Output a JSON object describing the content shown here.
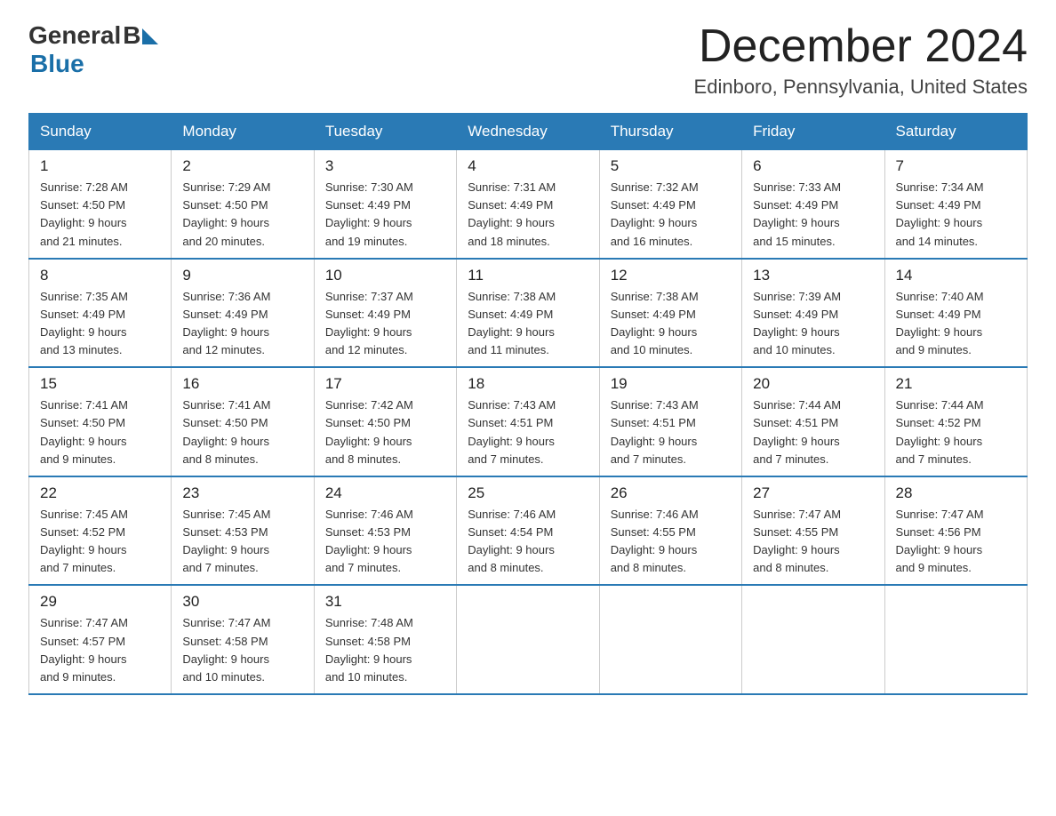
{
  "logo": {
    "general": "General",
    "blue": "Blue",
    "arrow": "▶"
  },
  "title": "December 2024",
  "subtitle": "Edinboro, Pennsylvania, United States",
  "days_of_week": [
    "Sunday",
    "Monday",
    "Tuesday",
    "Wednesday",
    "Thursday",
    "Friday",
    "Saturday"
  ],
  "weeks": [
    [
      {
        "day": "1",
        "sunrise": "7:28 AM",
        "sunset": "4:50 PM",
        "daylight": "9 hours and 21 minutes."
      },
      {
        "day": "2",
        "sunrise": "7:29 AM",
        "sunset": "4:50 PM",
        "daylight": "9 hours and 20 minutes."
      },
      {
        "day": "3",
        "sunrise": "7:30 AM",
        "sunset": "4:49 PM",
        "daylight": "9 hours and 19 minutes."
      },
      {
        "day": "4",
        "sunrise": "7:31 AM",
        "sunset": "4:49 PM",
        "daylight": "9 hours and 18 minutes."
      },
      {
        "day": "5",
        "sunrise": "7:32 AM",
        "sunset": "4:49 PM",
        "daylight": "9 hours and 16 minutes."
      },
      {
        "day": "6",
        "sunrise": "7:33 AM",
        "sunset": "4:49 PM",
        "daylight": "9 hours and 15 minutes."
      },
      {
        "day": "7",
        "sunrise": "7:34 AM",
        "sunset": "4:49 PM",
        "daylight": "9 hours and 14 minutes."
      }
    ],
    [
      {
        "day": "8",
        "sunrise": "7:35 AM",
        "sunset": "4:49 PM",
        "daylight": "9 hours and 13 minutes."
      },
      {
        "day": "9",
        "sunrise": "7:36 AM",
        "sunset": "4:49 PM",
        "daylight": "9 hours and 12 minutes."
      },
      {
        "day": "10",
        "sunrise": "7:37 AM",
        "sunset": "4:49 PM",
        "daylight": "9 hours and 12 minutes."
      },
      {
        "day": "11",
        "sunrise": "7:38 AM",
        "sunset": "4:49 PM",
        "daylight": "9 hours and 11 minutes."
      },
      {
        "day": "12",
        "sunrise": "7:38 AM",
        "sunset": "4:49 PM",
        "daylight": "9 hours and 10 minutes."
      },
      {
        "day": "13",
        "sunrise": "7:39 AM",
        "sunset": "4:49 PM",
        "daylight": "9 hours and 10 minutes."
      },
      {
        "day": "14",
        "sunrise": "7:40 AM",
        "sunset": "4:49 PM",
        "daylight": "9 hours and 9 minutes."
      }
    ],
    [
      {
        "day": "15",
        "sunrise": "7:41 AM",
        "sunset": "4:50 PM",
        "daylight": "9 hours and 9 minutes."
      },
      {
        "day": "16",
        "sunrise": "7:41 AM",
        "sunset": "4:50 PM",
        "daylight": "9 hours and 8 minutes."
      },
      {
        "day": "17",
        "sunrise": "7:42 AM",
        "sunset": "4:50 PM",
        "daylight": "9 hours and 8 minutes."
      },
      {
        "day": "18",
        "sunrise": "7:43 AM",
        "sunset": "4:51 PM",
        "daylight": "9 hours and 7 minutes."
      },
      {
        "day": "19",
        "sunrise": "7:43 AM",
        "sunset": "4:51 PM",
        "daylight": "9 hours and 7 minutes."
      },
      {
        "day": "20",
        "sunrise": "7:44 AM",
        "sunset": "4:51 PM",
        "daylight": "9 hours and 7 minutes."
      },
      {
        "day": "21",
        "sunrise": "7:44 AM",
        "sunset": "4:52 PM",
        "daylight": "9 hours and 7 minutes."
      }
    ],
    [
      {
        "day": "22",
        "sunrise": "7:45 AM",
        "sunset": "4:52 PM",
        "daylight": "9 hours and 7 minutes."
      },
      {
        "day": "23",
        "sunrise": "7:45 AM",
        "sunset": "4:53 PM",
        "daylight": "9 hours and 7 minutes."
      },
      {
        "day": "24",
        "sunrise": "7:46 AM",
        "sunset": "4:53 PM",
        "daylight": "9 hours and 7 minutes."
      },
      {
        "day": "25",
        "sunrise": "7:46 AM",
        "sunset": "4:54 PM",
        "daylight": "9 hours and 8 minutes."
      },
      {
        "day": "26",
        "sunrise": "7:46 AM",
        "sunset": "4:55 PM",
        "daylight": "9 hours and 8 minutes."
      },
      {
        "day": "27",
        "sunrise": "7:47 AM",
        "sunset": "4:55 PM",
        "daylight": "9 hours and 8 minutes."
      },
      {
        "day": "28",
        "sunrise": "7:47 AM",
        "sunset": "4:56 PM",
        "daylight": "9 hours and 9 minutes."
      }
    ],
    [
      {
        "day": "29",
        "sunrise": "7:47 AM",
        "sunset": "4:57 PM",
        "daylight": "9 hours and 9 minutes."
      },
      {
        "day": "30",
        "sunrise": "7:47 AM",
        "sunset": "4:58 PM",
        "daylight": "9 hours and 10 minutes."
      },
      {
        "day": "31",
        "sunrise": "7:48 AM",
        "sunset": "4:58 PM",
        "daylight": "9 hours and 10 minutes."
      },
      null,
      null,
      null,
      null
    ]
  ],
  "labels": {
    "sunrise": "Sunrise:",
    "sunset": "Sunset:",
    "daylight": "Daylight:"
  }
}
